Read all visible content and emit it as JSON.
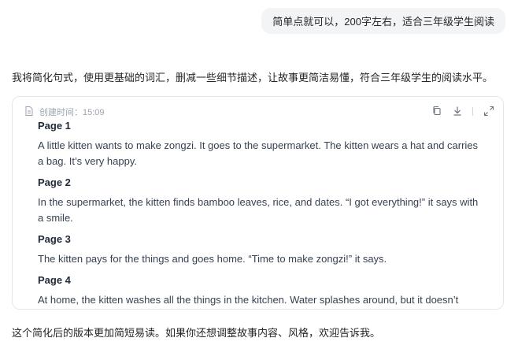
{
  "user_message": "简单点就可以，200字左右，适合三年级学生阅读",
  "assistant": {
    "intro": "我将简化句式，使用更基础的词汇，删减一些细节描述，让故事更简洁易懂，符合三年级学生的阅读水平。",
    "document": {
      "created_label": "创建时间：15:09",
      "icons": [
        "document-icon",
        "copy-icon",
        "download-icon",
        "expand-icon"
      ],
      "pages": [
        {
          "title": "Page 1",
          "text": "A little kitten wants to make zongzi. It goes to the supermarket. The kitten wears a hat and carries a bag. It’s very happy."
        },
        {
          "title": "Page 2",
          "text": "In the supermarket, the kitten finds bamboo leaves, rice, and dates. “I got everything!” it says with a smile."
        },
        {
          "title": "Page 3",
          "text": "The kitten pays for the things and goes home. “Time to make zongzi!” it says."
        },
        {
          "title": "Page 4",
          "text": "At home, the kitten washes all the things in the kitchen. Water splashes around, but it doesn’t"
        }
      ]
    },
    "outro": "这个简化后的版本更加简短易读。如果你还想调整故事内容、风格，欢迎告诉我。"
  }
}
